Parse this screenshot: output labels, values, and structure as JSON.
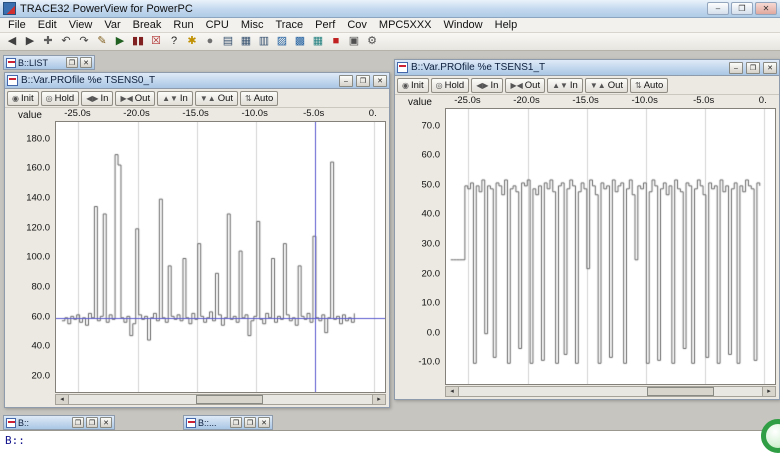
{
  "app": {
    "title": "TRACE32 PowerView for PowerPC"
  },
  "icons": {
    "minimize": "–",
    "maximize": "❐",
    "restore": "❐",
    "close": "✕",
    "scroll_left": "◂",
    "scroll_right": "▸"
  },
  "menu": {
    "items": [
      "File",
      "Edit",
      "View",
      "Var",
      "Break",
      "Run",
      "CPU",
      "Misc",
      "Trace",
      "Perf",
      "Cov",
      "MPC5XXX",
      "Window",
      "Help"
    ]
  },
  "toolbar": {
    "icons": [
      {
        "name": "back-icon",
        "glyph": "◀",
        "color": "#404040"
      },
      {
        "name": "forward-icon",
        "glyph": "▶",
        "color": "#404040"
      },
      {
        "name": "add-window-icon",
        "glyph": "✚",
        "color": "#606060"
      },
      {
        "name": "undo-icon",
        "glyph": "↶",
        "color": "#404040"
      },
      {
        "name": "redo-icon",
        "glyph": "↷",
        "color": "#404040"
      },
      {
        "name": "edit-icon",
        "glyph": "✎",
        "color": "#806020"
      },
      {
        "name": "go-icon",
        "glyph": "▶",
        "color": "#206020"
      },
      {
        "name": "break-icon",
        "glyph": "▮▮",
        "color": "#802020"
      },
      {
        "name": "close-window-icon",
        "glyph": "☒",
        "color": "#b03030"
      },
      {
        "name": "help-icon",
        "glyph": "?",
        "color": "#202020"
      },
      {
        "name": "tip-icon",
        "glyph": "✱",
        "color": "#c09000"
      },
      {
        "name": "breakpoint-icon",
        "glyph": "●",
        "color": "#707070"
      },
      {
        "name": "list-icon",
        "glyph": "▤",
        "color": "#35506e"
      },
      {
        "name": "dump-icon",
        "glyph": "▦",
        "color": "#35506e"
      },
      {
        "name": "register-icon",
        "glyph": "▥",
        "color": "#35506e"
      },
      {
        "name": "watch-icon",
        "glyph": "▨",
        "color": "#1f5fa0"
      },
      {
        "name": "memory-icon",
        "glyph": "▩",
        "color": "#1f5fa0"
      },
      {
        "name": "peripheral-icon",
        "glyph": "▦",
        "color": "#1f7f7f"
      },
      {
        "name": "stop-icon",
        "glyph": "■",
        "color": "#c02020"
      },
      {
        "name": "chip-icon",
        "glyph": "▣",
        "color": "#505050"
      },
      {
        "name": "tools-icon",
        "glyph": "⚙",
        "color": "#505050"
      }
    ]
  },
  "minimized": {
    "top": {
      "title": "B::LIST"
    },
    "bottom_left": {
      "title": "B::"
    },
    "bottom_right": {
      "title": "B::..."
    }
  },
  "charts": [
    {
      "title": "B::Var.PROfile %e TSENS0_T",
      "value_label": "value",
      "buttons": [
        {
          "name": "init-button",
          "glyph": "◉",
          "label": "Init"
        },
        {
          "name": "hold-button",
          "glyph": "◎",
          "label": "Hold"
        },
        {
          "name": "zoom-in-button",
          "glyph": "◀▶",
          "label": "In"
        },
        {
          "name": "zoom-out-button",
          "glyph": "▶◀",
          "label": "Out"
        },
        {
          "name": "scale-in-button",
          "glyph": "▲▼",
          "label": "In"
        },
        {
          "name": "scale-out-button",
          "glyph": "▼▲",
          "label": "Out"
        },
        {
          "name": "auto-button",
          "glyph": "⇅",
          "label": "Auto"
        }
      ],
      "time_ticks": [
        {
          "label": "-25.0s",
          "x": -25
        },
        {
          "label": "-20.0s",
          "x": -20
        },
        {
          "label": "-15.0s",
          "x": -15
        },
        {
          "label": "-10.0s",
          "x": -10
        },
        {
          "label": "-5.0s",
          "x": -5
        },
        {
          "label": "0.",
          "x": 0
        }
      ],
      "y_ticks": [
        {
          "label": "180.0",
          "value": 180
        },
        {
          "label": "160.0",
          "value": 160
        },
        {
          "label": "140.0",
          "value": 140
        },
        {
          "label": "120.0",
          "value": 120
        },
        {
          "label": "100.0",
          "value": 100
        },
        {
          "label": "80.0",
          "value": 80
        },
        {
          "label": "60.0",
          "value": 60
        },
        {
          "label": "40.0",
          "value": 40
        },
        {
          "label": "20.0",
          "value": 20
        }
      ],
      "chart_data": {
        "type": "line",
        "xlabel": "time (s)",
        "ylabel": "value",
        "xlim": [
          -26.9,
          0.95
        ],
        "ylim": [
          10,
          192
        ],
        "x_start": -26.4,
        "x_step": 0.25,
        "line_color": "#666666",
        "cursor": {
          "x": -5.0,
          "y": 60
        },
        "cursor_color": "#5a5ad0",
        "values": [
          58,
          60,
          56,
          61,
          59,
          62,
          57,
          60,
          55,
          63,
          60,
          135,
          58,
          61,
          130,
          57,
          62,
          59,
          170,
          163,
          60,
          57,
          61,
          48,
          56,
          120,
          62,
          59,
          61,
          45,
          60,
          63,
          58,
          140,
          60,
          57,
          95,
          61,
          59,
          62,
          58,
          100,
          60,
          56,
          63,
          59,
          110,
          61,
          57,
          60,
          64,
          58,
          90,
          62,
          55,
          60,
          130,
          59,
          61,
          57,
          105,
          60,
          62,
          48,
          58,
          61,
          125,
          59,
          56,
          63,
          60,
          100,
          57,
          61,
          59,
          110,
          62,
          58,
          60,
          55,
          95,
          61,
          59,
          63,
          57,
          115,
          60,
          58,
          62,
          50,
          60,
          165,
          59,
          61,
          56,
          62,
          58,
          60,
          57,
          63
        ]
      }
    },
    {
      "title": "B::Var.PROfile %e TSENS1_T",
      "value_label": "value",
      "buttons": [
        {
          "name": "init-button",
          "glyph": "◉",
          "label": "Init"
        },
        {
          "name": "hold-button",
          "glyph": "◎",
          "label": "Hold"
        },
        {
          "name": "zoom-in-button",
          "glyph": "◀▶",
          "label": "In"
        },
        {
          "name": "zoom-out-button",
          "glyph": "▶◀",
          "label": "Out"
        },
        {
          "name": "scale-in-button",
          "glyph": "▲▼",
          "label": "In"
        },
        {
          "name": "scale-out-button",
          "glyph": "▼▲",
          "label": "Out"
        },
        {
          "name": "auto-button",
          "glyph": "⇅",
          "label": "Auto"
        }
      ],
      "time_ticks": [
        {
          "label": "-25.0s",
          "x": -25
        },
        {
          "label": "-20.0s",
          "x": -20
        },
        {
          "label": "-15.0s",
          "x": -15
        },
        {
          "label": "-10.0s",
          "x": -10
        },
        {
          "label": "-5.0s",
          "x": -5
        },
        {
          "label": "0.",
          "x": 0
        }
      ],
      "y_ticks": [
        {
          "label": "70.0",
          "value": 70
        },
        {
          "label": "60.0",
          "value": 60
        },
        {
          "label": "50.0",
          "value": 50
        },
        {
          "label": "40.0",
          "value": 40
        },
        {
          "label": "30.0",
          "value": 30
        },
        {
          "label": "20.0",
          "value": 20
        },
        {
          "label": "10.0",
          "value": 10
        },
        {
          "label": "0.0",
          "value": 0
        },
        {
          "label": "-10.0",
          "value": -10
        }
      ],
      "chart_data": {
        "type": "line",
        "xlabel": "time (s)",
        "ylabel": "value",
        "xlim": [
          -26.9,
          0.95
        ],
        "ylim": [
          -17,
          76
        ],
        "x_start": -26.5,
        "x_step": 0.24,
        "line_color": "#666666",
        "cursor": null,
        "cursor_color": "#5a5ad0",
        "values": [
          25,
          25,
          25,
          25,
          25,
          50,
          49,
          51,
          -10,
          50,
          48,
          52,
          0,
          50,
          49,
          -8,
          51,
          50,
          47,
          52,
          -10,
          49,
          50,
          48,
          -5,
          51,
          50,
          52,
          -10,
          49,
          47,
          50,
          -9,
          51,
          49,
          52,
          48,
          -10,
          50,
          51,
          -7,
          49,
          52,
          50,
          -10,
          48,
          51,
          49,
          22,
          52,
          50,
          47,
          -10,
          51,
          49,
          50,
          -8,
          52,
          48,
          50,
          51,
          -10,
          49,
          52,
          47,
          25,
          50,
          49,
          51,
          -10,
          48,
          52,
          50,
          -9,
          49,
          51,
          47,
          50,
          -10,
          52,
          49,
          48,
          -5,
          51,
          50,
          -10,
          49,
          52,
          50,
          47,
          -8,
          51,
          49,
          50,
          -10,
          52,
          48,
          50,
          -7,
          49,
          51,
          -10,
          50,
          48,
          52,
          50,
          49,
          -9,
          51,
          50
        ]
      }
    }
  ],
  "cmdline": {
    "prompt": "B::"
  }
}
